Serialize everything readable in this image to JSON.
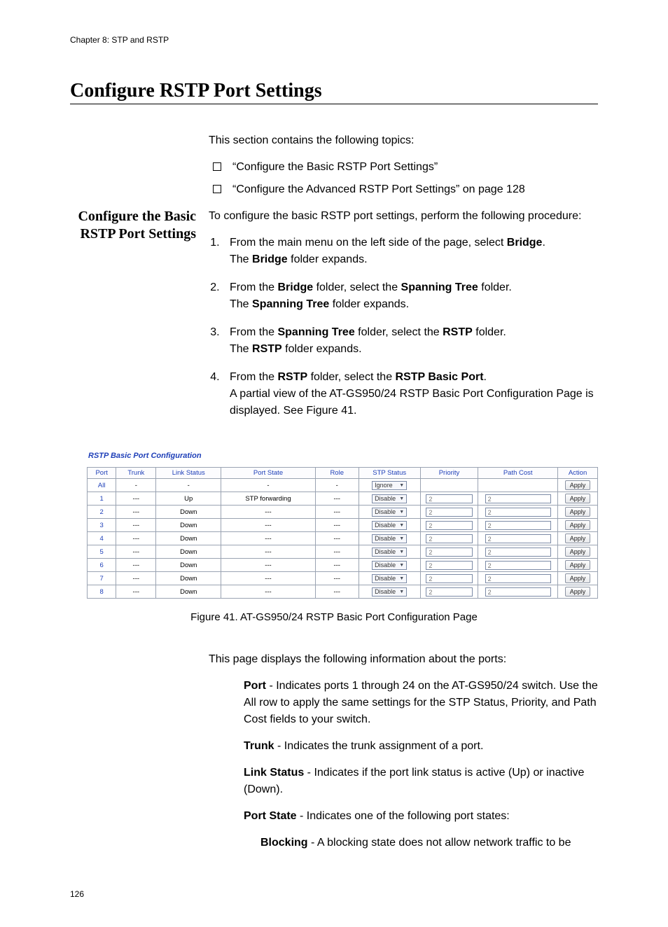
{
  "running_head": "Chapter 8: STP and RSTP",
  "section_title": "Configure RSTP Port Settings",
  "intro": "This section contains the following topics:",
  "topics": [
    "“Configure the Basic RSTP Port Settings”",
    "“Configure the Advanced RSTP Port Settings” on page 128"
  ],
  "sidehead": "Configure the Basic RSTP Port Settings",
  "procedure_intro": "To configure the basic RSTP port settings, perform the following procedure:",
  "steps": [
    {
      "pre": "From the main menu on the left side of the page, select ",
      "bold1": "Bridge",
      "post1": ".",
      "line2_pre": "The ",
      "line2_bold": "Bridge",
      "line2_post": " folder expands."
    },
    {
      "pre": "From the ",
      "bold1": "Bridge",
      "mid1": " folder, select the ",
      "bold2": "Spanning Tree",
      "post1": " folder.",
      "line2_pre": "The ",
      "line2_bold": "Spanning Tree",
      "line2_post": " folder expands."
    },
    {
      "pre": "From the ",
      "bold1": "Spanning Tree",
      "mid1": " folder, select the ",
      "bold2": "RSTP",
      "post1": " folder.",
      "line2_pre": "The ",
      "line2_bold": "RSTP",
      "line2_post": " folder expands."
    },
    {
      "pre": "From the ",
      "bold1": "RSTP",
      "mid1": " folder, select the ",
      "bold2": "RSTP Basic Port",
      "post1": ".",
      "line2_plain": "A partial view of the AT-GS950/24 RSTP Basic Port Configuration Page is displayed. See Figure 41."
    }
  ],
  "figure": {
    "title": "RSTP Basic Port Configuration",
    "headers": [
      "Port",
      "Trunk",
      "Link Status",
      "Port State",
      "Role",
      "STP Status",
      "Priority",
      "Path Cost",
      "Action"
    ],
    "stp_all": "Ignore",
    "stp_row": "Disable",
    "priority_val": "2",
    "pathcost_val": "2",
    "btn": "Apply",
    "rows": [
      {
        "port": "All",
        "trunk": "-",
        "link": "-",
        "state": "-",
        "role": "-"
      },
      {
        "port": "1",
        "trunk": "---",
        "link": "Up",
        "state": "STP forwarding",
        "role": "---"
      },
      {
        "port": "2",
        "trunk": "---",
        "link": "Down",
        "state": "---",
        "role": "---"
      },
      {
        "port": "3",
        "trunk": "---",
        "link": "Down",
        "state": "---",
        "role": "---"
      },
      {
        "port": "4",
        "trunk": "---",
        "link": "Down",
        "state": "---",
        "role": "---"
      },
      {
        "port": "5",
        "trunk": "---",
        "link": "Down",
        "state": "---",
        "role": "---"
      },
      {
        "port": "6",
        "trunk": "---",
        "link": "Down",
        "state": "---",
        "role": "---"
      },
      {
        "port": "7",
        "trunk": "---",
        "link": "Down",
        "state": "---",
        "role": "---"
      },
      {
        "port": "8",
        "trunk": "---",
        "link": "Down",
        "state": "---",
        "role": "---"
      }
    ],
    "caption": "Figure 41. AT-GS950/24 RSTP Basic Port Configuration Page"
  },
  "after_fig_intro": "This page displays the following information about the ports:",
  "defs": {
    "port_label": "Port",
    "port_text": " - Indicates ports 1 through 24 on the AT-GS950/24 switch. Use the All row to apply the same settings for the STP Status, Priority, and Path Cost fields to your switch.",
    "trunk_label": "Trunk",
    "trunk_text": " - Indicates the trunk assignment of a port.",
    "link_label": "Link Status",
    "link_text": " - Indicates if the port link status is active (Up) or inactive (Down).",
    "state_label": "Port State",
    "state_text": " - Indicates one of the following port states:",
    "blocking_label": "Blocking",
    "blocking_text": " - A blocking state does not allow network traffic to be"
  },
  "page_number": "126"
}
